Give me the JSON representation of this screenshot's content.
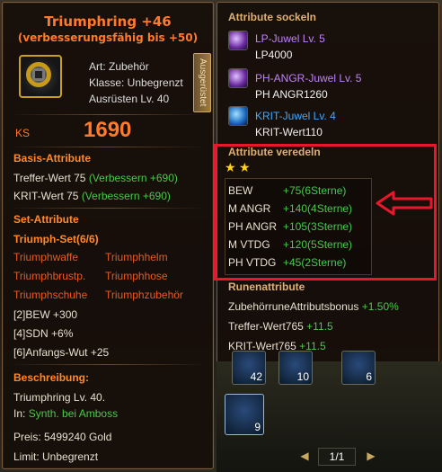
{
  "tooltip": {
    "title": "Triumphring  +46",
    "subtitle": "(verbesserungsfähig bis +50)",
    "info": [
      "Art: Zubehör",
      "Klasse: Unbegrenzt",
      "Ausrüsten Lv. 40"
    ],
    "equip_label": "Ausgerüstet",
    "ks_label": "KS",
    "ks_value": "1690",
    "basis_header": "Basis-Attribute",
    "basis": [
      {
        "label": "Treffer-Wert 75",
        "bonus": "(Verbessern +690)"
      },
      {
        "label": "KRIT-Wert 75",
        "bonus": "(Verbessern +690)"
      }
    ],
    "set_header": "Set-Attribute",
    "set_title": "Triumph-Set(6/6)",
    "set_items": [
      "Triumphwaffe",
      "Triumphhelm",
      "Triumphbrustp.",
      "Triumphhose",
      "Triumphschuhe",
      "Triumphzubehör"
    ],
    "set_bonuses": [
      "[2]BEW +300",
      "[4]SDN +6%",
      "[6]Anfangs-Wut +25"
    ],
    "desc_header": "Beschreibung:",
    "desc_line1": "Triumphring Lv. 40.",
    "desc_in": "In:",
    "desc_source": "Synth. bei Amboss",
    "price": "Preis: 5499240 Gold",
    "limit": "Limit: Unbegrenzt"
  },
  "sockets": {
    "header": "Attribute sockeln",
    "gems": [
      {
        "name": "LP-Juwel Lv. 5",
        "value": "LP4000",
        "color": "#c080ff",
        "icon": "purple-gem-icon"
      },
      {
        "name": "PH-ANGR-Juwel Lv. 5",
        "value": "PH ANGR1260",
        "color": "#c080ff",
        "icon": "purple-gem-icon"
      },
      {
        "name": "KRIT-Juwel Lv. 4",
        "value": "KRIT-Wert110",
        "color": "#40a8ff",
        "icon": "blue-gem-icon"
      }
    ]
  },
  "refine": {
    "header": "Attribute veredeln",
    "stars": [
      "★",
      "★"
    ],
    "rows": [
      {
        "label": "BEW",
        "value": "+75(6Sterne)"
      },
      {
        "label": "M ANGR",
        "value": "+140(4Sterne)"
      },
      {
        "label": "PH ANGR",
        "value": "+105(3Sterne)"
      },
      {
        "label": "M VTDG",
        "value": "+120(5Sterne)"
      },
      {
        "label": "PH VTDG",
        "value": "+45(2Sterne)"
      }
    ]
  },
  "runes": {
    "header": "Runenattribute",
    "rows": [
      {
        "label": "ZubehörruneAttributsbonus",
        "value": "+1.50%"
      },
      {
        "label": "Treffer-Wert765",
        "value": "+11.5"
      },
      {
        "label": "KRIT-Wert765",
        "value": "+11.5"
      }
    ]
  },
  "inventory": {
    "counts": [
      "42",
      "10",
      "6",
      "9"
    ],
    "page": "1/1",
    "prev": "◀",
    "next": "▶"
  },
  "colors": {
    "accent": "#ff7a2a",
    "bonus": "#4ac84a",
    "highlight": "#e8182a"
  }
}
